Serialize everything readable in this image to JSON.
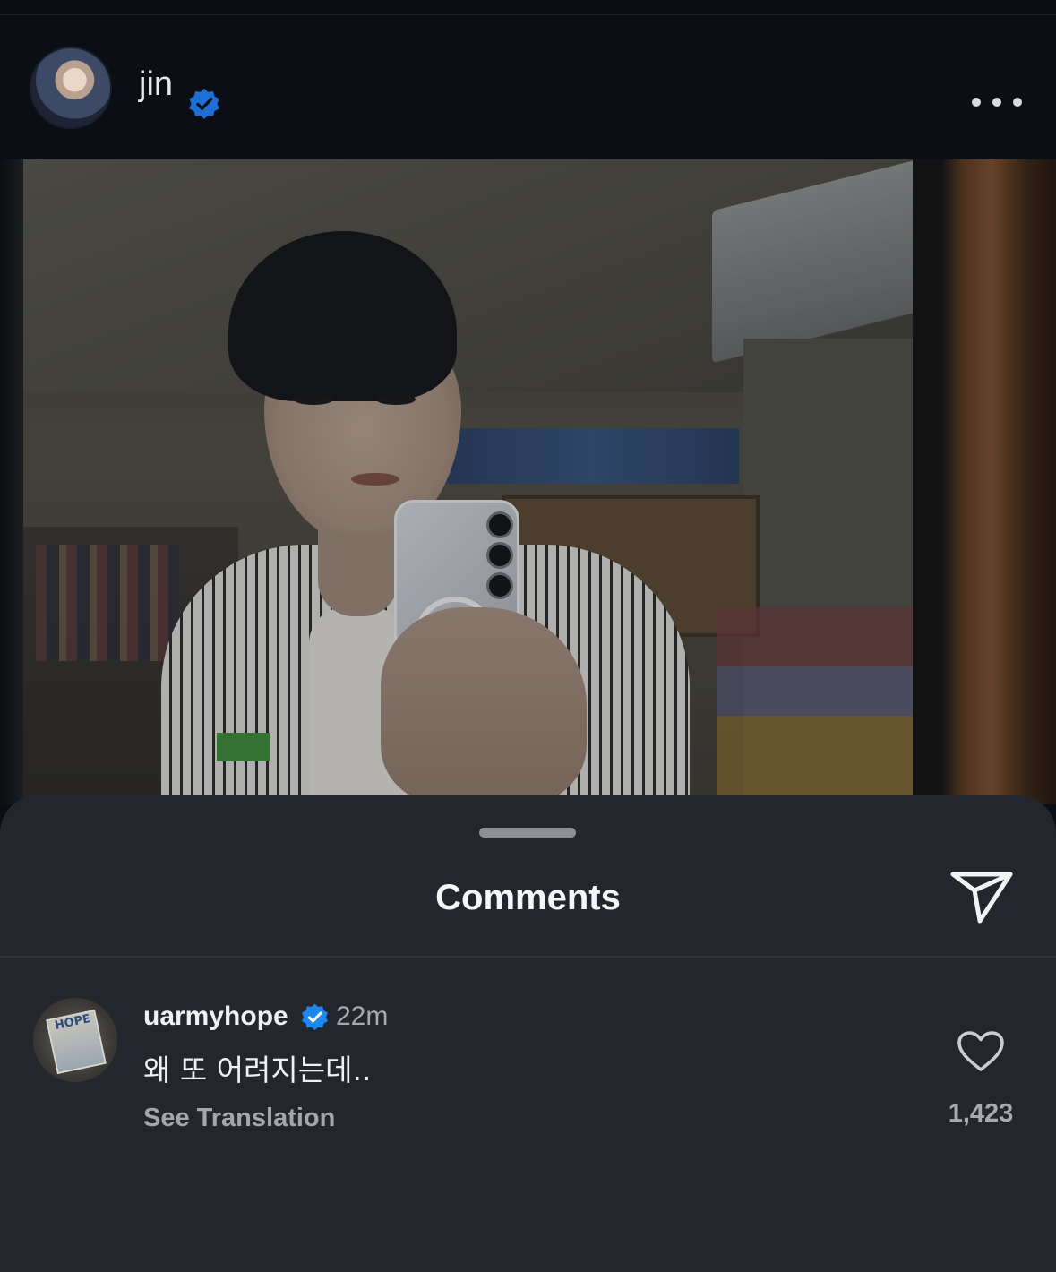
{
  "post": {
    "username": "jin",
    "verified": true,
    "more_icon": "more-horizontal-icon"
  },
  "comments_sheet": {
    "title": "Comments",
    "share_icon": "send-icon"
  },
  "comments": [
    {
      "username": "uarmyhope",
      "verified": true,
      "time": "22m",
      "text": "왜 또 어려지는데..",
      "see_translation": "See Translation",
      "likes": "1,423",
      "like_icon": "heart-outline-icon",
      "avatar_text": "HOPE"
    }
  ],
  "colors": {
    "background": "#0b0e15",
    "sheet": "#23262c",
    "verified_blue": "#1e88f0",
    "muted_text": "#a7aab1"
  }
}
